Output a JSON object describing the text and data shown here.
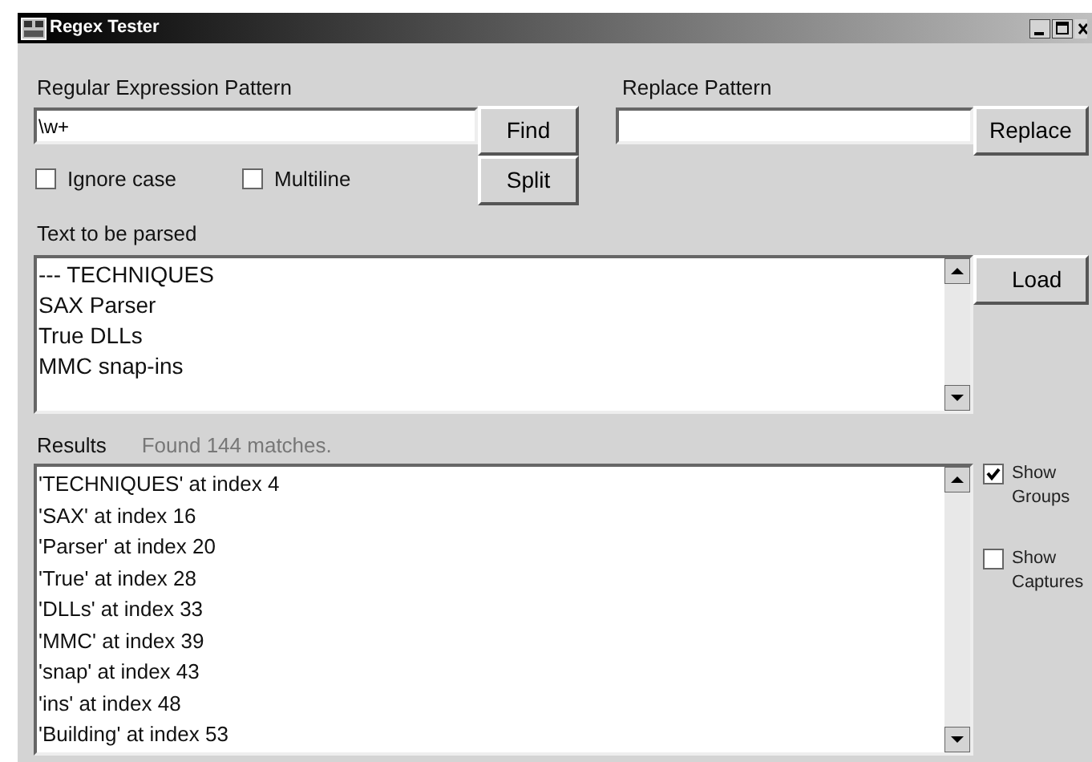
{
  "window": {
    "title": "Regex Tester"
  },
  "pattern": {
    "label": "Regular Expression Pattern",
    "value": "\\w+"
  },
  "find_button": "Find",
  "split_button": "Split",
  "replace": {
    "label": "Replace Pattern"
  },
  "replace_button": "Replace",
  "options": [
    {
      "label": "Ignore case",
      "checked": false
    },
    {
      "label": "Multiline",
      "checked": false
    }
  ],
  "input": {
    "label": "Text to be parsed",
    "lines": [
      "--- TECHNIQUES",
      "SAX Parser",
      "True DLLs",
      "MMC snap-ins"
    ]
  },
  "load_button": "Load",
  "results": {
    "label": "Results",
    "summary": "Found 144 matches.",
    "lines": [
      "'TECHNIQUES' at index 4",
      "'SAX' at index 16",
      "'Parser' at index 20",
      "'True' at index 28",
      "'DLLs' at index 33",
      "'MMC' at index 39",
      "'snap' at index 43",
      "'ins' at index 48",
      "'Building' at index 53"
    ]
  },
  "result_options": [
    {
      "label": "Show Groups",
      "checked": true
    },
    {
      "label": "Show Captures",
      "checked": false
    }
  ]
}
